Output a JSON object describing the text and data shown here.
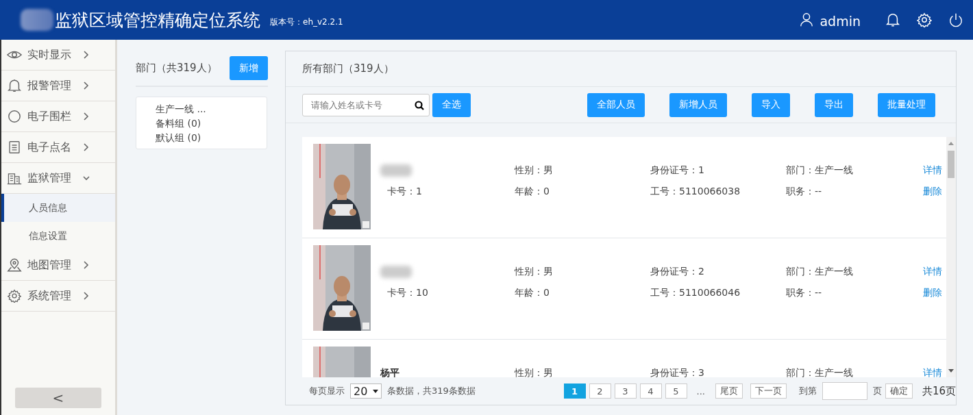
{
  "header": {
    "title": "监狱区域管控精确定位系统",
    "version": "版本号：eh_v2.2.1",
    "user": "admin"
  },
  "sidebar": {
    "items": [
      {
        "label": "实时显示",
        "kind": "eye",
        "expanded": false
      },
      {
        "label": "报警管理",
        "kind": "bell",
        "expanded": false
      },
      {
        "label": "电子围栏",
        "kind": "circle",
        "expanded": false
      },
      {
        "label": "电子点名",
        "kind": "list",
        "expanded": false
      },
      {
        "label": "监狱管理",
        "kind": "building",
        "expanded": true,
        "children": [
          {
            "label": "人员信息",
            "selected": true
          },
          {
            "label": "信息设置",
            "selected": false
          }
        ]
      },
      {
        "label": "地图管理",
        "kind": "pin",
        "expanded": false
      },
      {
        "label": "系统管理",
        "kind": "gear",
        "expanded": false
      }
    ],
    "collapse": "<"
  },
  "departments": {
    "title": "部门（共319人）",
    "add": "新增",
    "items": [
      "生产一线 ...",
      "备料组 (0)",
      "默认组 (0)"
    ]
  },
  "people": {
    "title": "所有部门（319人）",
    "search": {
      "placeholder": "请输入姓名或卡号"
    },
    "select_all": "全选",
    "buttons": [
      "全部人员",
      "新增人员",
      "导入",
      "导出",
      "批量处理"
    ],
    "rows": [
      {
        "name_blurred": true,
        "card": "卡号：1",
        "gender": "性别：男",
        "age": "年龄：0",
        "id_no": "身份证号：1",
        "work_no": "工号：5110066038",
        "dept": "部门：生产一线",
        "duty": "职务：--",
        "detail": "详情",
        "delete": "删除"
      },
      {
        "name_blurred": true,
        "card": "卡号：10",
        "gender": "性别：男",
        "age": "年龄：0",
        "id_no": "身份证号：2",
        "work_no": "工号：5110066046",
        "dept": "部门：生产一线",
        "duty": "职务：--",
        "detail": "详情",
        "delete": "删除"
      },
      {
        "name": "杨平",
        "name_blurred": false,
        "gender": "性别：男",
        "id_no": "身份证号：3",
        "dept": "部门：生产一线",
        "detail": "详情"
      }
    ],
    "pager": {
      "per_page_label": "每页显示",
      "per_page": "20",
      "summary": "条数据，共319条数据",
      "pages": [
        {
          "label": "1",
          "selected": true
        },
        {
          "label": "2",
          "selected": false
        },
        {
          "label": "3",
          "selected": false
        },
        {
          "label": "4",
          "selected": false
        },
        {
          "label": "5",
          "selected": false
        }
      ],
      "ellipsis": "...",
      "last": "尾页",
      "next": "下一页",
      "goto": "到第",
      "page_unit": "页",
      "confirm": "确定",
      "total": "共16页"
    }
  }
}
